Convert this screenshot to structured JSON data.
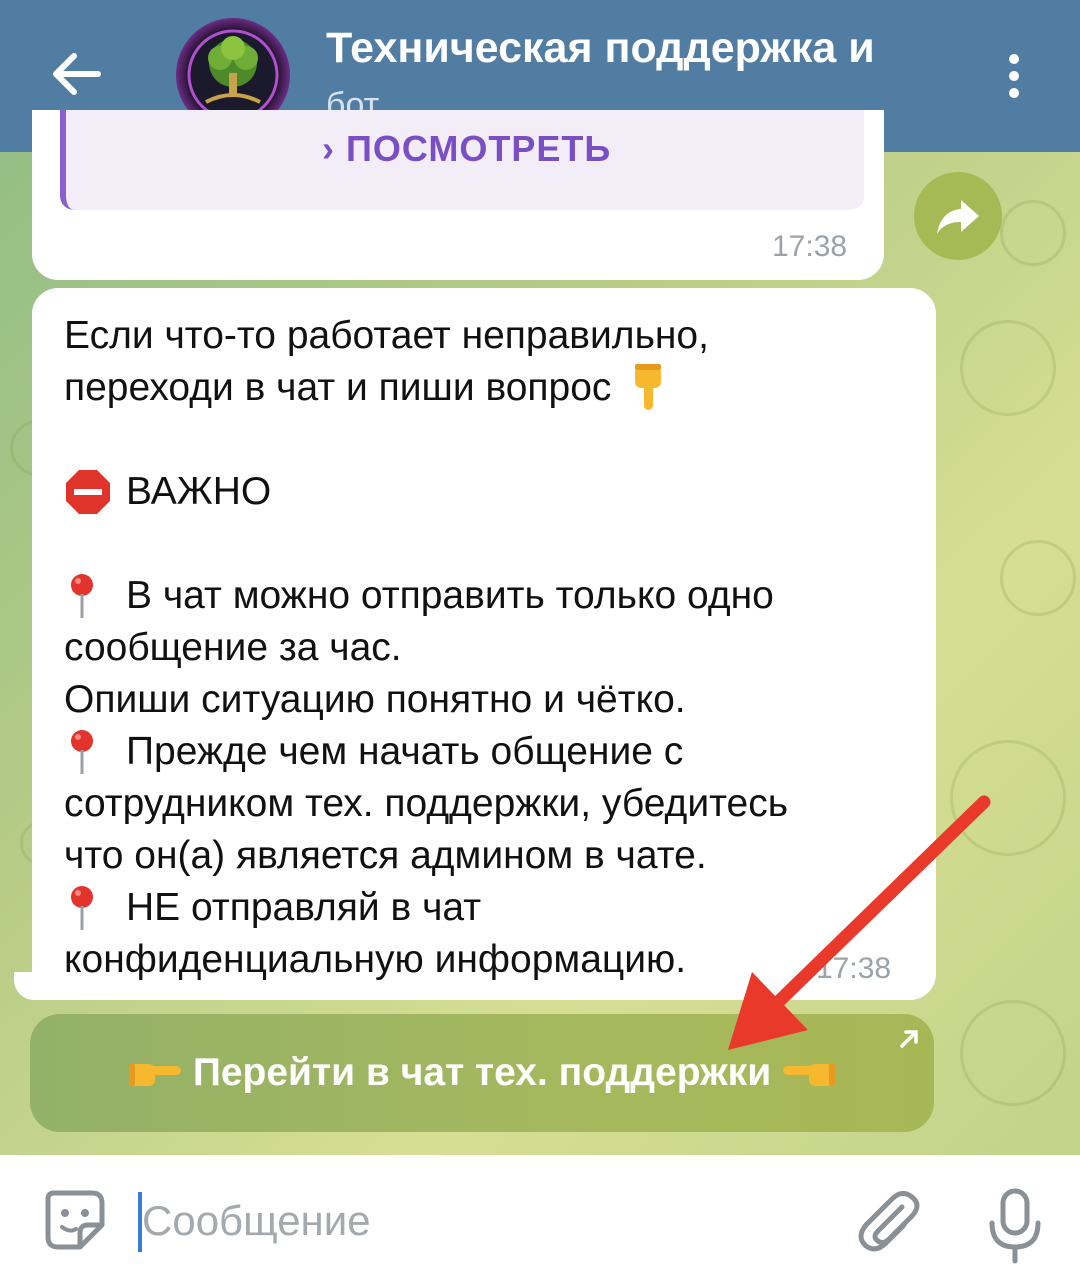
{
  "header": {
    "title": "Техническая поддержка и",
    "subtitle": "бот",
    "color": "#527da3"
  },
  "messages": [
    {
      "inline_button_label": "› ПОСМОТРЕТЬ",
      "time": "17:38"
    },
    {
      "lines": [
        "Если что-то работает неправильно,",
        "переходи в чат и пиши вопрос",
        "",
        "ВАЖНО",
        "",
        "В чат можно отправить только одно",
        "сообщение за час.",
        "Опиши ситуацию понятно и чётко.",
        "Прежде чем начать общение с",
        "сотрудником тех. поддержки, убедитесь",
        "что он(а) является админом в чате.",
        "НЕ отправляй в чат",
        "конфиденциальную информацию."
      ],
      "time": "17:38"
    }
  ],
  "inline_button": {
    "label": "Перейти в чат тех. поддержки"
  },
  "input": {
    "placeholder": "Сообщение"
  },
  "icons": {
    "back": "arrow-left-icon",
    "menu": "more-vertical-icon",
    "share": "share-icon",
    "sticker": "sticker-icon",
    "attach": "paperclip-icon",
    "mic": "microphone-icon"
  },
  "annotation_color": "#e8392b"
}
